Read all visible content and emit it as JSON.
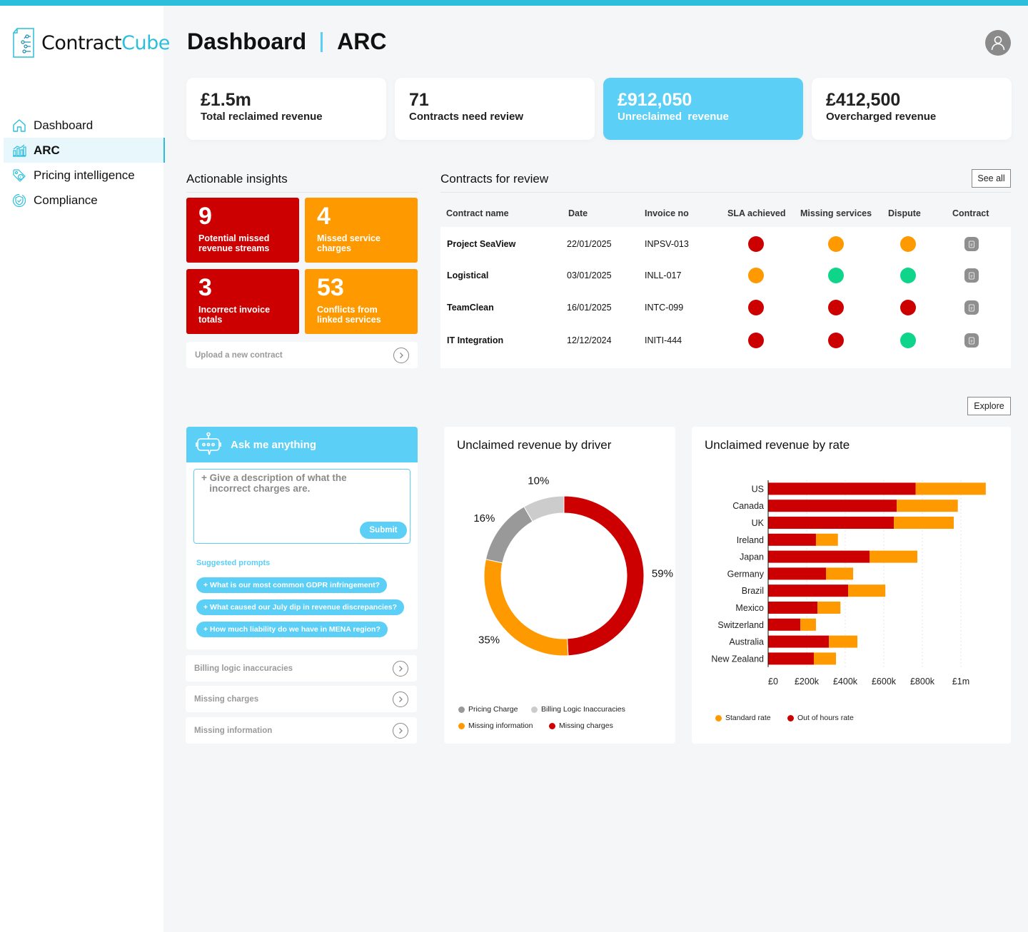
{
  "app": {
    "logo": {
      "name_part1": "Contract",
      "name_part2": "Cube"
    },
    "accent_color": "#2bbfdc",
    "highlight_color": "#5bcff5"
  },
  "sidebar": {
    "items": [
      {
        "label": "Dashboard",
        "icon": "home-icon",
        "active": false
      },
      {
        "label": "ARC",
        "icon": "chart-icon",
        "active": true
      },
      {
        "label": "Pricing intelligence",
        "icon": "price-tag-icon",
        "active": false
      },
      {
        "label": "Compliance",
        "icon": "shield-icon",
        "active": false
      }
    ]
  },
  "header": {
    "title": "Dashboard",
    "subtitle": "ARC",
    "avatar_icon": "user-icon"
  },
  "kpis": [
    {
      "value": "£1.5m",
      "label": "Total reclaimed revenue",
      "highlight": false
    },
    {
      "value": "71",
      "label": "Contracts need review",
      "highlight": false
    },
    {
      "value": "£912,050",
      "label": "Unreclaimed  revenue",
      "highlight": true
    },
    {
      "value": "£412,500",
      "label": "Overcharged revenue",
      "highlight": false
    }
  ],
  "insights": {
    "title": "Actionable insights",
    "tiles": [
      {
        "value": "9",
        "label": "Potential missed revenue streams",
        "color": "#cc0000"
      },
      {
        "value": "4",
        "label": "Missed service charges",
        "color": "#ff9900"
      },
      {
        "value": "3",
        "label": "Incorrect invoice totals",
        "color": "#cc0000"
      },
      {
        "value": "53",
        "label": "Conflicts from linked services",
        "color": "#ff9900"
      }
    ],
    "upload_label": "Upload a new contract"
  },
  "contracts": {
    "title": "Contracts for review",
    "see_all_label": "See all",
    "columns": [
      "Contract name",
      "Date",
      "Invoice no",
      "SLA achieved",
      "Missing services",
      "Dispute",
      "Contract"
    ],
    "status_colors": {
      "red": "#cc0000",
      "orange": "#ff9900",
      "green": "#0fd58a"
    },
    "rows": [
      {
        "name": "Project SeaView",
        "date": "22/01/2025",
        "invoice": "INPSV-013",
        "sla": "red",
        "missing": "orange",
        "dispute": "orange"
      },
      {
        "name": "Logistical",
        "date": "03/01/2025",
        "invoice": "INLL-017",
        "sla": "orange",
        "missing": "green",
        "dispute": "green"
      },
      {
        "name": "TeamClean",
        "date": "16/01/2025",
        "invoice": "INTC-099",
        "sla": "red",
        "missing": "red",
        "dispute": "red"
      },
      {
        "name": "IT Integration",
        "date": "12/12/2024",
        "invoice": "INITI-444",
        "sla": "red",
        "missing": "red",
        "dispute": "green"
      }
    ]
  },
  "explore_label": "Explore",
  "chat": {
    "title": "Ask me anything",
    "placeholder": "+ Give a description of what the\n   incorrect charges are.",
    "submit_label": "Submit",
    "suggested_title": "Suggested prompts",
    "prompts": [
      "+ What is our most common GDPR infringement?",
      "+ What caused our July dip in revenue discrepancies?",
      "+ How much liability do we have in MENA region?"
    ]
  },
  "quick_links": [
    "Billing logic inaccuracies",
    "Missing charges",
    "Missing information"
  ],
  "chart_data": [
    {
      "type": "pie",
      "title": "Unclaimed revenue by driver",
      "donut": true,
      "slices": [
        {
          "label": "Missing charges",
          "value": 59,
          "display": "59%",
          "color": "#cc0000"
        },
        {
          "label": "Missing information",
          "value": 35,
          "display": "35%",
          "color": "#ff9900"
        },
        {
          "label": "Pricing Charge",
          "value": 16,
          "display": "16%",
          "color": "#999999"
        },
        {
          "label": "Billing Logic Inaccuracies",
          "value": 10,
          "display": "10%",
          "color": "#cccccc"
        }
      ],
      "legend": [
        {
          "label": "Pricing Charge",
          "color": "#999999"
        },
        {
          "label": "Billing Logic Inaccuracies",
          "color": "#cccccc"
        },
        {
          "label": "Missing information",
          "color": "#ff9900"
        },
        {
          "label": "Missing charges",
          "color": "#cc0000"
        }
      ],
      "legend_position": "bottom"
    },
    {
      "type": "bar",
      "orientation": "horizontal",
      "stacked": true,
      "title": "Unclaimed revenue by rate",
      "categories": [
        "US",
        "Canada",
        "UK",
        "Ireland",
        "Japan",
        "Germany",
        "Brazil",
        "Mexico",
        "Switzerland",
        "Australia",
        "New Zealand"
      ],
      "series": [
        {
          "name": "Out of hours rate",
          "color": "#cc0000",
          "values": [
            765000,
            667000,
            652000,
            248000,
            526000,
            300000,
            415000,
            256000,
            167000,
            315000,
            237000
          ]
        },
        {
          "name": "Standard rate",
          "color": "#ff9900",
          "values": [
            364000,
            317000,
            311000,
            114000,
            248000,
            141000,
            193000,
            119000,
            81000,
            148000,
            115000
          ]
        }
      ],
      "xticks": [
        {
          "value": 0,
          "label": "£0"
        },
        {
          "value": 200000,
          "label": "£200k"
        },
        {
          "value": 400000,
          "label": "£400k"
        },
        {
          "value": 600000,
          "label": "£600k"
        },
        {
          "value": 800000,
          "label": "£800k"
        },
        {
          "value": 1000000,
          "label": "£1m"
        }
      ],
      "xlim": [
        0,
        1000000
      ],
      "grid": true,
      "legend": [
        {
          "label": "Standard rate",
          "color": "#ff9900"
        },
        {
          "label": "Out of hours rate",
          "color": "#cc0000"
        }
      ],
      "legend_position": "bottom-left"
    }
  ]
}
